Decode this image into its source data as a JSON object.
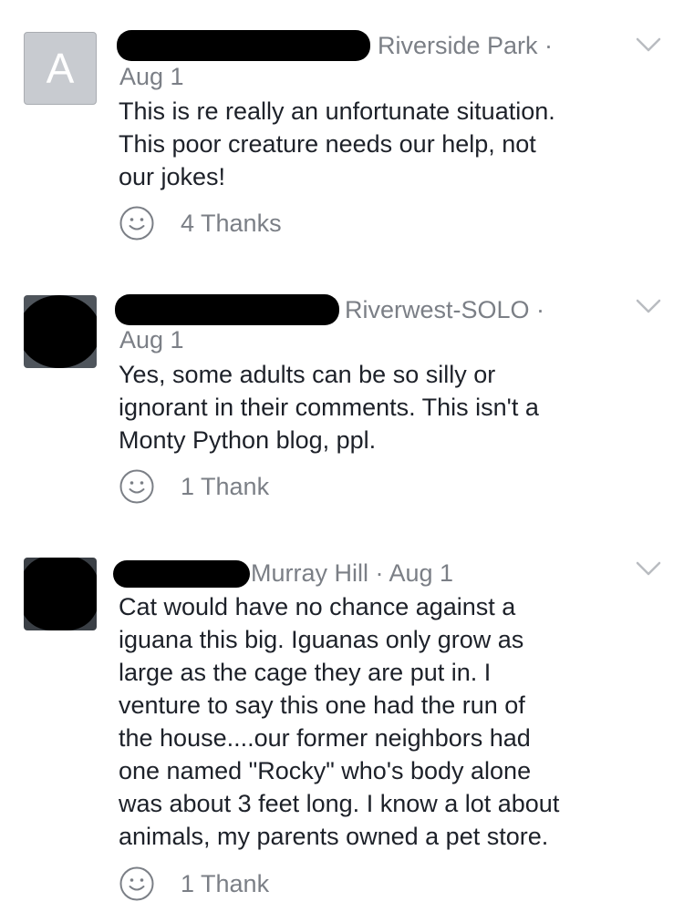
{
  "comments": [
    {
      "avatar_letter": "A",
      "neighborhood": "Riverside Park ·",
      "date": "Aug 1",
      "text": "This is re really an unfortunate situation.\nThis poor creature needs our help, not\nour jokes!",
      "thanks": "4 Thanks"
    },
    {
      "neighborhood": "Riverwest-SOLO ·",
      "date": "Aug 1",
      "text": "Yes, some adults can be so silly or\nignorant in their comments. This isn't a\nMonty Python blog, ppl.",
      "thanks": "1 Thank"
    },
    {
      "meta_line": "Murray Hill · Aug 1",
      "text": "Cat would have no chance against a\niguana this big. Iguanas only grow as\nlarge as the cage they are put in. I\nventure to say this one had the run of\nthe house....our former neighbors had\none named \"Rocky\" who's body alone\nwas about 3 feet long. I know a lot about\nanimals, my parents owned a pet store.",
      "thanks": "1 Thank"
    }
  ],
  "icons": {
    "more": "chevron-down-icon",
    "thank": "smiley-icon"
  },
  "colors": {
    "meta_text": "#7b7f86",
    "body_text": "#1d2129",
    "avatar_placeholder": "#c8cbd0",
    "redaction": "#000000"
  }
}
